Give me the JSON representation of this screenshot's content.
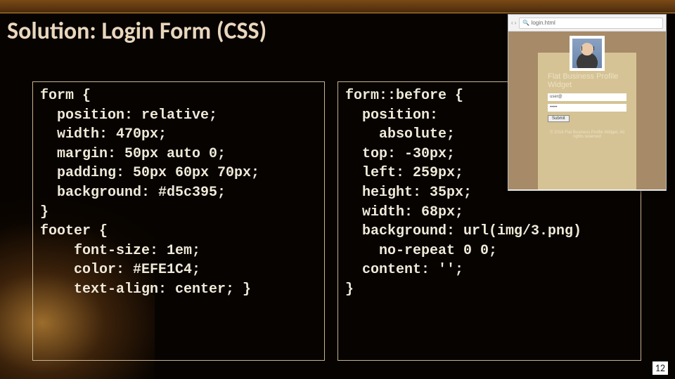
{
  "title": "Solution: Login Form (CSS)",
  "code_left": "form {\n  position: relative;\n  width: 470px;\n  margin: 50px auto 0;\n  padding: 50px 60px 70px;\n  background: #d5c395;\n}\nfooter {\n    font-size: 1em;\n    color: #EFE1C4;\n    text-align: center; }",
  "code_right": "form::before {\n  position:\n    absolute;\n  top: -30px;\n  left: 259px;\n  height: 35px;\n  width: 68px;\n  background: url(img/3.png)\n    no-repeat 0 0;\n  content: '';\n}",
  "page_number": "12",
  "thumb": {
    "address": "login.html",
    "nav_back": "‹",
    "nav_fwd": "›",
    "nav_search": "🔍",
    "heading": "Flat Business Profile Widget",
    "field_user": "user@",
    "field_pass": "•••••",
    "submit": "Submit",
    "footer": "© 2016 Flat Business Profile Widget. All rights reserved"
  }
}
